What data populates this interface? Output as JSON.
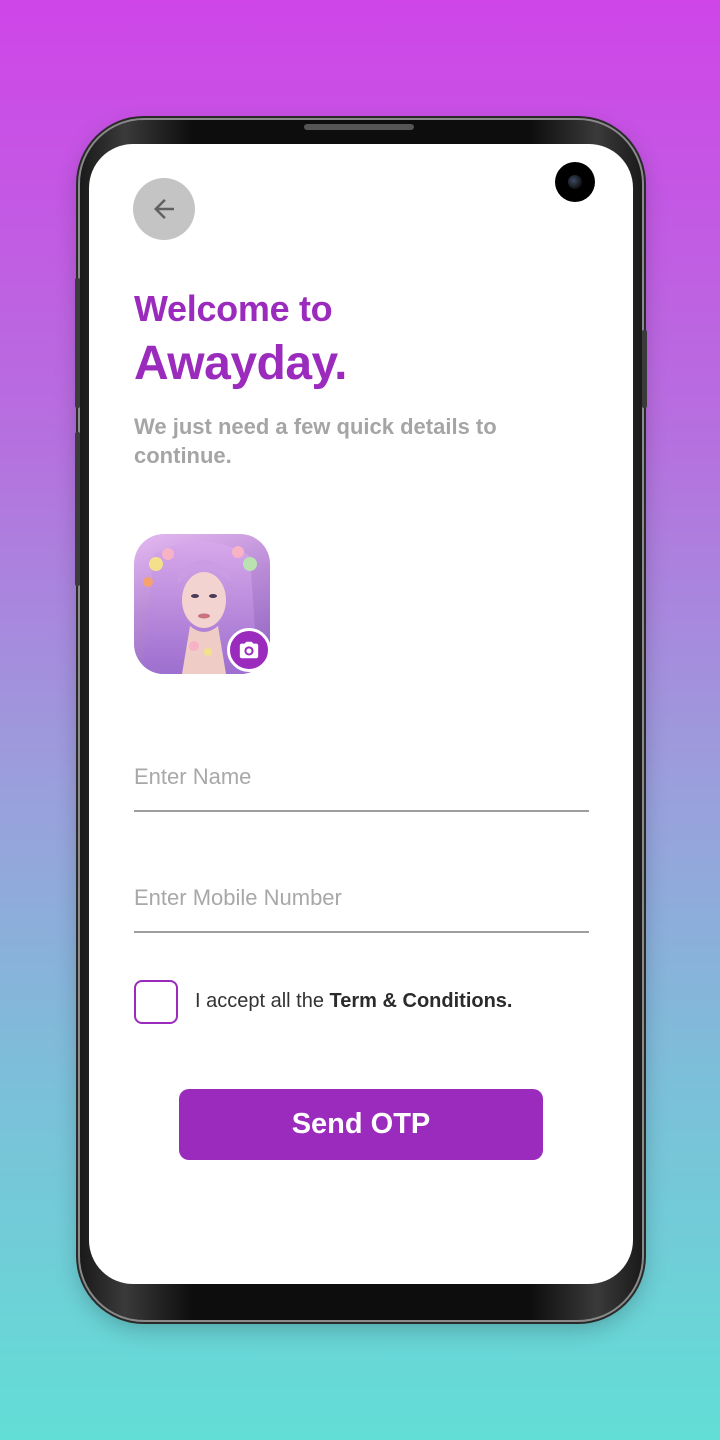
{
  "header": {
    "back_icon": "arrow-left-icon",
    "welcome_text": "Welcome to",
    "brand_text": "Awayday."
  },
  "intro": {
    "subtitle": "We just need a few quick details to continue."
  },
  "profile": {
    "camera_icon": "camera-icon"
  },
  "form": {
    "name_placeholder": "Enter Name",
    "name_value": "",
    "mobile_placeholder": "Enter Mobile Number",
    "mobile_value": "",
    "terms_prefix": "I accept all the ",
    "terms_link": "Term & Conditions.",
    "terms_checked": false
  },
  "actions": {
    "send_label": "Send OTP"
  },
  "colors": {
    "accent": "#9b2bbd",
    "muted_text": "#a5a5a5",
    "back_button_bg": "#c4c4c4"
  }
}
